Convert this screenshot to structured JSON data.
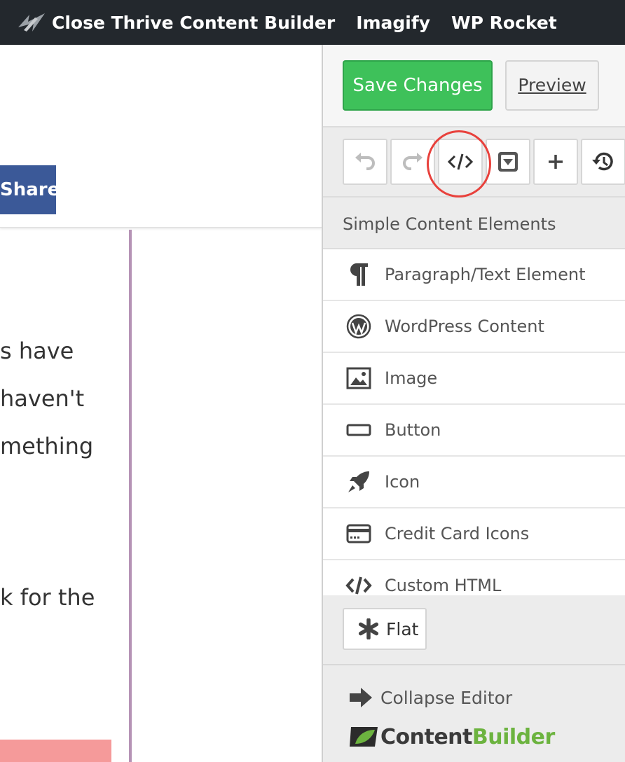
{
  "adminbar": {
    "items": [
      "Close Thrive Content Builder",
      "Imagify",
      "WP Rocket"
    ]
  },
  "page": {
    "share_label": "Share",
    "text_fragments": [
      "s have",
      " haven't",
      "mething",
      "k for the"
    ]
  },
  "editor": {
    "save_label": "Save Changes",
    "preview_label": "Preview",
    "toolbar": [
      {
        "icon": "undo-icon"
      },
      {
        "icon": "redo-icon"
      },
      {
        "icon": "code-icon",
        "highlighted": true
      },
      {
        "icon": "dropdown-box-icon"
      },
      {
        "icon": "plus-icon"
      },
      {
        "icon": "history-icon"
      }
    ],
    "section_title": "Simple Content Elements",
    "elements": [
      {
        "label": "Paragraph/Text Element",
        "icon": "paragraph-icon"
      },
      {
        "label": "WordPress Content",
        "icon": "wordpress-icon"
      },
      {
        "label": "Image",
        "icon": "image-icon"
      },
      {
        "label": "Button",
        "icon": "button-icon"
      },
      {
        "label": "Icon",
        "icon": "rocket-icon"
      },
      {
        "label": "Credit Card Icons",
        "icon": "credit-card-icon"
      },
      {
        "label": "Custom HTML",
        "icon": "code-icon"
      }
    ],
    "flat_label": "Flat",
    "collapse_label": "Collapse Editor",
    "brand": {
      "part1": "Content",
      "part2": "Builder"
    }
  },
  "colors": {
    "adminbar_bg": "#23282d",
    "save_green": "#3ec15a",
    "share_blue": "#3b5998",
    "highlight_red": "#e8413c",
    "brand_green": "#6cb33f"
  }
}
